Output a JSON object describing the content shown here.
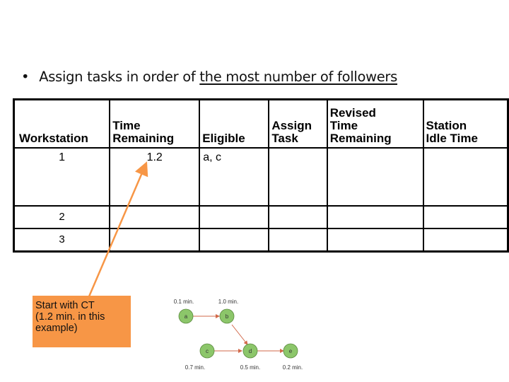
{
  "bullet": {
    "symbol": "•",
    "prefix": "Assign tasks in order of ",
    "emphasis": "the most number of followers"
  },
  "table": {
    "headers": [
      [
        "",
        "Workstation"
      ],
      [
        "Time",
        "Remaining"
      ],
      [
        "",
        "Eligible"
      ],
      [
        "Assign",
        "Task"
      ],
      [
        "Revised",
        "Time",
        "Remaining"
      ],
      [
        "Station",
        "Idle Time"
      ]
    ],
    "rows": [
      {
        "workstation": "1",
        "time_remaining": "1.2",
        "eligible": "a, c",
        "assign_task": "",
        "revised_time_remaining": "",
        "idle_time": ""
      },
      {
        "workstation": "2",
        "time_remaining": "",
        "eligible": "",
        "assign_task": "",
        "revised_time_remaining": "",
        "idle_time": ""
      },
      {
        "workstation": "3",
        "time_remaining": "",
        "eligible": "",
        "assign_task": "",
        "revised_time_remaining": "",
        "idle_time": ""
      }
    ]
  },
  "callout": {
    "text_lines": [
      "Start with CT",
      "(1.2 min. in this",
      "example)"
    ],
    "color": "#f79646"
  },
  "network": {
    "nodes": [
      {
        "id": "a",
        "time": "0.1 min."
      },
      {
        "id": "b",
        "time": "1.0 min."
      },
      {
        "id": "c",
        "time": "0.7 min."
      },
      {
        "id": "d",
        "time": "0.5 min."
      },
      {
        "id": "e",
        "time": "0.2 min."
      }
    ],
    "edges": [
      [
        "a",
        "b"
      ],
      [
        "b",
        "d"
      ],
      [
        "c",
        "d"
      ],
      [
        "d",
        "e"
      ]
    ],
    "node_color": "#8cc66a",
    "edge_color": "#d2694a"
  }
}
